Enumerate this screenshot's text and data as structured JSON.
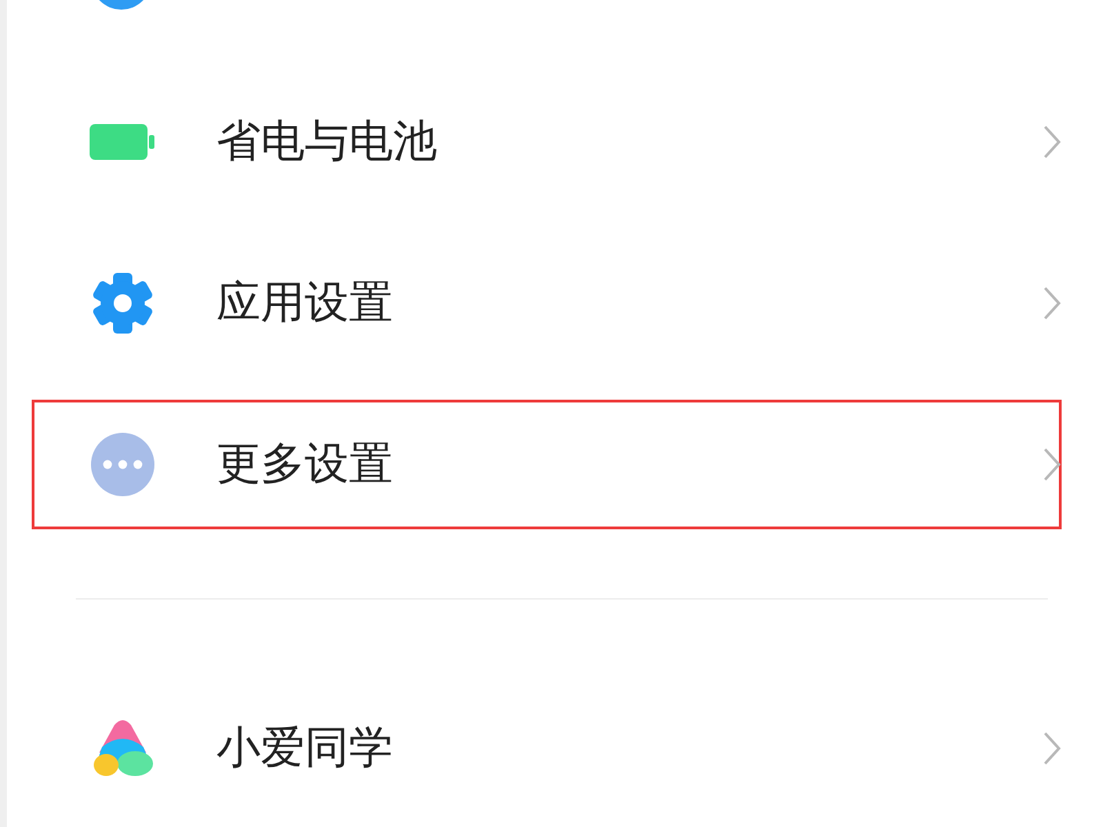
{
  "groups": [
    {
      "items": [
        {
          "kind": "battery",
          "label": "省电与电池",
          "highlighted": false
        },
        {
          "kind": "gear",
          "label": "应用设置",
          "highlighted": false
        },
        {
          "kind": "more",
          "label": "更多设置",
          "highlighted": true
        }
      ]
    },
    {
      "items": [
        {
          "kind": "assistant",
          "label": "小爱同学",
          "highlighted": false
        }
      ]
    }
  ]
}
